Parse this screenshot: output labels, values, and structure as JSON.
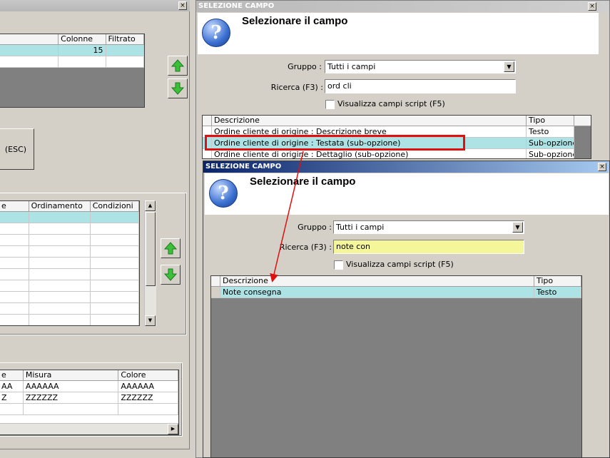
{
  "back_window": {
    "top_grid": {
      "headers": [
        "",
        "Colonne",
        "Filtrato"
      ],
      "rows": [
        {
          "c0": "",
          "c1": "15",
          "c2": ""
        },
        {
          "c0": "",
          "c1": "",
          "c2": ""
        }
      ]
    },
    "esc_button_label": "(ESC)",
    "mid_grid": {
      "headers": [
        "e",
        "Ordinamento",
        "Condizioni"
      ]
    },
    "bottom_grid": {
      "headers": [
        "e",
        "Misura",
        "Colore"
      ],
      "rows": [
        {
          "c0": "AA",
          "c1": "AAAAAA",
          "c2": "AAAAAA"
        },
        {
          "c0": "Z",
          "c1": "ZZZZZZ",
          "c2": "ZZZZZZ"
        }
      ]
    },
    "close_symbol": "×"
  },
  "dialog_back": {
    "title": "SELEZIONE CAMPO",
    "heading": "Selezionare il campo",
    "gruppo_label": "Gruppo :",
    "gruppo_value": "Tutti i campi",
    "ricerca_label": "Ricerca (F3) :",
    "ricerca_value": "ord cli",
    "checkbox_label": "Visualizza campi script (F5)",
    "grid_headers": [
      "Descrizione",
      "Tipo"
    ],
    "rows": [
      {
        "descrizione": "Ordine cliente di origine : Descrizione breve",
        "tipo": "Testo"
      },
      {
        "descrizione": "Ordine cliente di origine : Testata (sub-opzione)",
        "tipo": "Sub-opzione"
      },
      {
        "descrizione": "Ordine cliente di origine : Dettaglio (sub-opzione)",
        "tipo": "Sub-opzione"
      }
    ],
    "close_symbol": "×",
    "help_symbol": "?"
  },
  "dialog_front": {
    "title": "SELEZIONE CAMPO",
    "heading": "Selezionare il campo",
    "gruppo_label": "Gruppo :",
    "gruppo_value": "Tutti i campi",
    "ricerca_label": "Ricerca (F3) :",
    "ricerca_value": "note con",
    "checkbox_label": "Visualizza campi script (F5)",
    "grid_headers": [
      "Descrizione",
      "Tipo"
    ],
    "rows": [
      {
        "descrizione": "Note consegna",
        "tipo": "Testo"
      }
    ],
    "close_symbol": "×",
    "help_symbol": "?"
  },
  "colors": {
    "selection": "#aee3e6",
    "highlight_yellow": "#f5f59a",
    "annotation_red": "#e01010",
    "active_title": "#0a246a"
  }
}
